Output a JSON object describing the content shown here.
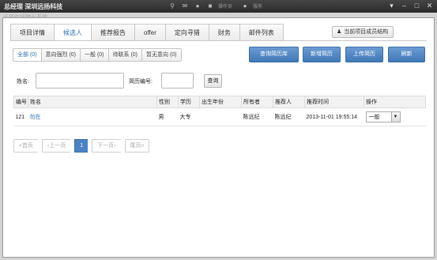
{
  "app": {
    "title": "总经理 深圳远扬科技"
  },
  "topbar": {
    "labels": [
      "",
      "",
      "",
      "操作员",
      "服务"
    ],
    "win_controls": [
      "▾",
      "–",
      "□",
      "✕"
    ]
  },
  "ghost": "远扬在线猎头系统",
  "tabs": [
    {
      "label": "项目详情"
    },
    {
      "label": "候选人"
    },
    {
      "label": "推荐报告"
    },
    {
      "label": "offer"
    },
    {
      "label": "定向寻猎"
    },
    {
      "label": "财务"
    },
    {
      "label": "邮件列表"
    }
  ],
  "active_tab": "候选人",
  "members_button": "当前项目成员结构",
  "filters": [
    {
      "label": "全部 (0)"
    },
    {
      "label": "意向强烈 (0)"
    },
    {
      "label": "一般 (0)"
    },
    {
      "label": "待联系 (0)"
    },
    {
      "label": "暂无意向 (0)"
    }
  ],
  "actions": {
    "query_db": "查询简历库",
    "new_resume": "新增简历",
    "upload_resume": "上传简历",
    "refresh": "刷新"
  },
  "search": {
    "name_label": "姓名:",
    "name_value": "",
    "resume_no_label": "简历编号:",
    "resume_no_value": "",
    "query_button": "查询"
  },
  "table": {
    "headers": [
      "编号",
      "姓名",
      "性别",
      "学历",
      "出生年份",
      "所有者",
      "推荐人",
      "推荐时间",
      "操作"
    ],
    "rows": [
      {
        "id": "121",
        "name": "勿在",
        "gender": "男",
        "edu": "大专",
        "birth": "",
        "owner": "陈远纪",
        "referrer": "陈远纪",
        "time": "2013-11-01 19:55:14",
        "op": "一般"
      }
    ]
  },
  "pager": {
    "first": "«首页",
    "prev": "‹上一页",
    "current": "1",
    "next": "下一页›",
    "last": "尾页»"
  }
}
